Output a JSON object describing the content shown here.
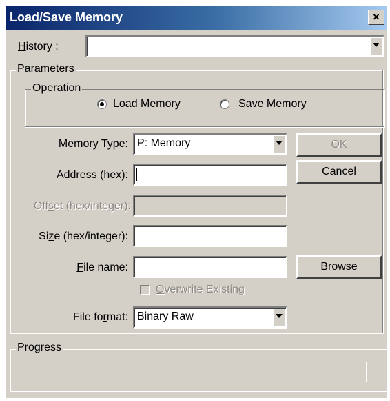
{
  "window": {
    "title": "Load/Save Memory",
    "close_label": "×"
  },
  "history": {
    "label": "History :",
    "value": ""
  },
  "parameters": {
    "group_label": "Parameters",
    "operation": {
      "group_label": "Operation",
      "load_label": "Load Memory",
      "save_label": "Save Memory",
      "selected": "load"
    },
    "memory_type": {
      "label": "Memory Type:",
      "value": "P: Memory"
    },
    "address": {
      "label": "Address (hex):",
      "value": ""
    },
    "offset": {
      "label": "Offset (hex/integer):",
      "value": ""
    },
    "size": {
      "label": "Size (hex/integer):",
      "value": ""
    },
    "file_name": {
      "label": "File name:",
      "value": ""
    },
    "overwrite": {
      "label": "Overwrite Existing",
      "checked": false
    },
    "file_format": {
      "label": "File format:",
      "value": "Binary Raw"
    }
  },
  "buttons": {
    "ok": "OK",
    "cancel": "Cancel",
    "browse": "Browse"
  },
  "progress": {
    "group_label": "Progress",
    "percent": 0
  }
}
